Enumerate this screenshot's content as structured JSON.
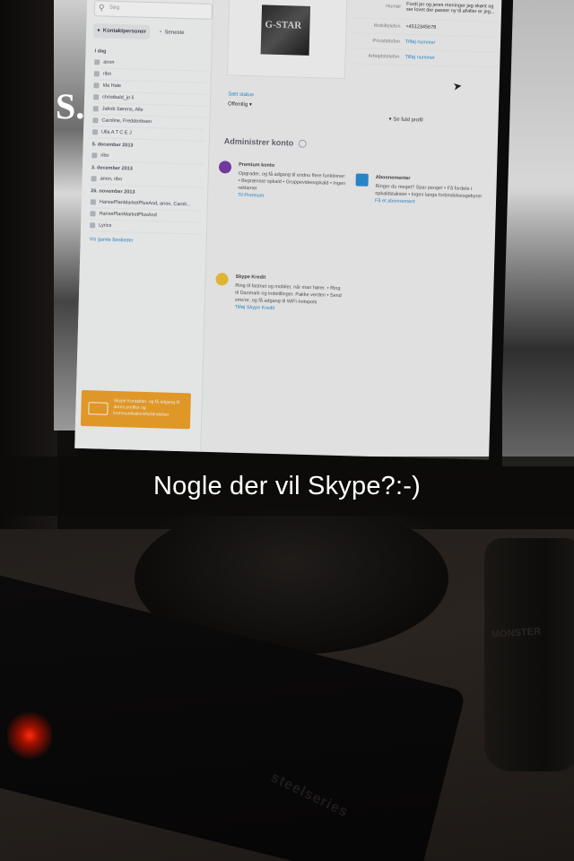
{
  "caption": "Nogle der vil Skype?:-)",
  "screen": {
    "search_placeholder": "Søg",
    "tabs": [
      {
        "label": "Kontaktpersoner"
      },
      {
        "label": "Seneste"
      }
    ],
    "contact_groups": [
      {
        "heading": "I dag",
        "items": [
          "anon",
          "ribo",
          "Ida Hale",
          "christbald_jo li",
          "Jakob Sørens, Alle",
          "Caroline, Fredderiksen",
          "Ulla A T C E J"
        ]
      },
      {
        "heading": "5. december 2013",
        "items": [
          "ribo"
        ]
      },
      {
        "heading": "3. december 2013",
        "items": [
          "anon, ribo"
        ]
      },
      {
        "heading": "26. november 2013",
        "items": [
          "HansePlanMarketPlusAnd, anon, Caroli...",
          "HansePlanMarketPlusAnd",
          "Lyrics"
        ]
      }
    ],
    "contacts_link": "Vis gamle Beskeder",
    "promo_text": "Skype Kontakter, og få adgang til deres profiler og kommunikationsforbindelser",
    "profile_photo_label": "G-STAR",
    "status_link": "Sæt status",
    "status_value": "Offentlig",
    "details": [
      {
        "label": "Humør",
        "value": "Fordi jer og jeres meninger jeg skønt og ser lovet der passer ny til afviller er jeg..."
      },
      {
        "label": "Mobiltelefon",
        "value": "+4512345678"
      },
      {
        "label": "Privattelefon",
        "value": "Tilføj nummer"
      },
      {
        "label": "Arbejdstelefon",
        "value": "Tilføj nummer"
      }
    ],
    "see_profile": "Se fuld profil",
    "manage_title": "Administrer konto",
    "cards": [
      {
        "title": "Premium konto",
        "body": "Opgrader, og få adgang til endnu flere funktioner: • Begrænset opkald • Gruppevideoopkald • Ingen reklamer",
        "link": "Til Premium",
        "color": "#7b3ea8"
      },
      {
        "title": "Abonnementer",
        "body": "Ringer du meget? Spar penge! • Få fordele i opkaldstakster • Ingen lange forbindelsesgebyrer",
        "link": "Få et abonnement",
        "color": "#2a8fd6"
      },
      {
        "title": "Skype Kredit",
        "body": "Ring til fastnet og mobiler, når man hører. • Ring til Danmark og indstillinger. Pakke verden • Send sms'er, og få adgang til WiFi-hotspots",
        "link": "Tilføj Skype Kredit",
        "color": "#f2c43a"
      }
    ]
  },
  "scene_labels": {
    "poster_left": "S.",
    "keyboard_brand": "steelseries",
    "cup_label": "MONSTER"
  }
}
